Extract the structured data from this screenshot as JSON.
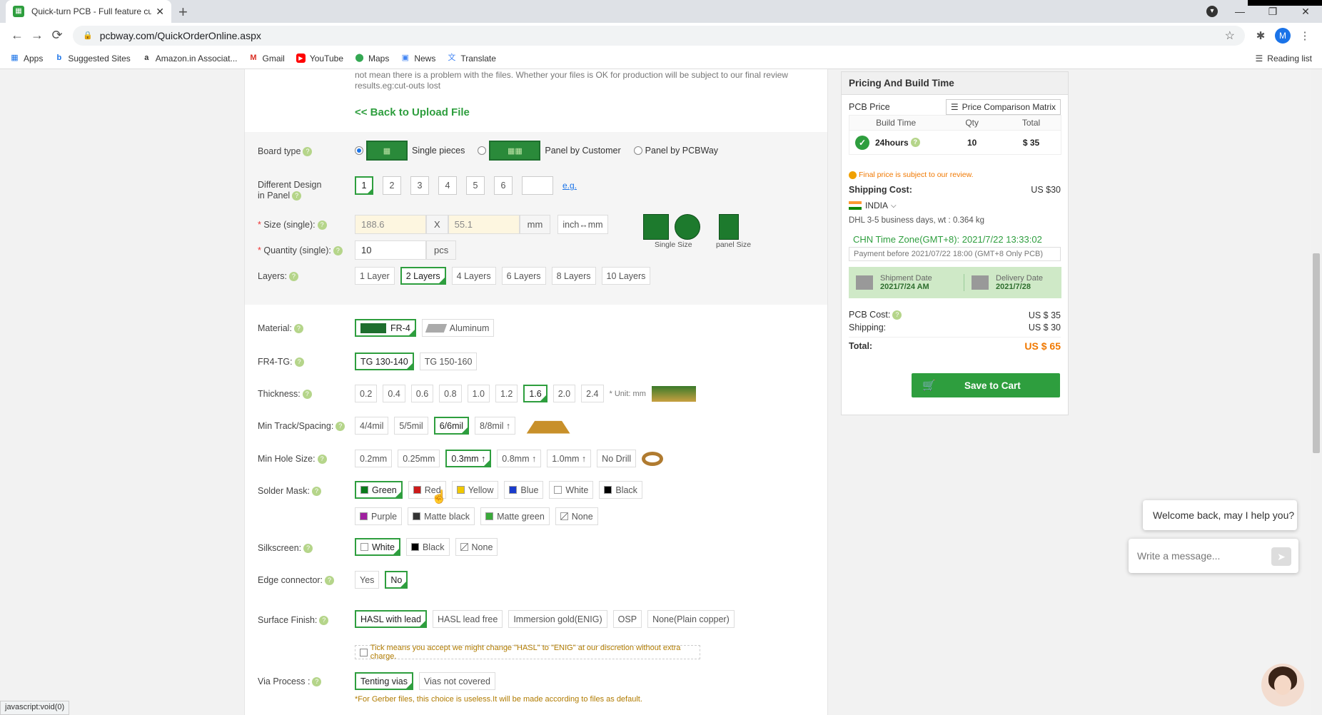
{
  "browser": {
    "tab_title": "Quick-turn PCB - Full feature cus",
    "url": "pcbway.com/QuickOrderOnline.aspx",
    "avatar_letter": "M",
    "bookmarks": [
      {
        "label": "Apps",
        "icon": "apps-grid-icon"
      },
      {
        "label": "Suggested Sites",
        "icon": "bing-icon"
      },
      {
        "label": "Amazon.in Associat...",
        "icon": "amazon-icon"
      },
      {
        "label": "Gmail",
        "icon": "gmail-icon"
      },
      {
        "label": "YouTube",
        "icon": "youtube-icon"
      },
      {
        "label": "Maps",
        "icon": "maps-icon"
      },
      {
        "label": "News",
        "icon": "news-icon"
      },
      {
        "label": "Translate",
        "icon": "translate-icon"
      }
    ],
    "reading_list": "Reading list",
    "status_text": "javascript:void(0)"
  },
  "form": {
    "notice": "Because of the imperfect algorithm of our Gerber to image tool, it may cause inaccurate display of PCB images, which does not mean there is a problem with the files. Whether your files is OK for production will be subject to our final review results.eg:cut-outs lost",
    "back_link": "<< Back to Upload File",
    "board_type": {
      "label": "Board type",
      "options": [
        "Single pieces",
        "Panel by Customer",
        "Panel by PCBWay"
      ],
      "selected": "Single pieces"
    },
    "different_design": {
      "label_line1": "Different Design",
      "label_line2": "in Panel",
      "options": [
        "1",
        "2",
        "3",
        "4",
        "5",
        "6"
      ],
      "selected": "1",
      "eg_link": "e.g."
    },
    "size": {
      "label": "Size (single):",
      "width": "188.6",
      "x": "X",
      "height": "55.1",
      "unit": "mm",
      "convert": "inch↔mm",
      "single_size_caption": "Single Size",
      "panel_size_caption": "panel Size"
    },
    "quantity": {
      "label": "Quantity (single):",
      "value": "10",
      "unit": "pcs"
    },
    "layers": {
      "label": "Layers:",
      "options": [
        "1 Layer",
        "2 Layers",
        "4 Layers",
        "6 Layers",
        "8 Layers",
        "10 Layers"
      ],
      "selected": "2 Layers"
    },
    "material": {
      "label": "Material:",
      "options": [
        "FR-4",
        "Aluminum"
      ],
      "selected": "FR-4"
    },
    "fr4_tg": {
      "label": "FR4-TG:",
      "options": [
        "TG 130-140",
        "TG 150-160"
      ],
      "selected": "TG 130-140"
    },
    "thickness": {
      "label": "Thickness:",
      "options": [
        "0.2",
        "0.4",
        "0.6",
        "0.8",
        "1.0",
        "1.2",
        "1.6",
        "2.0",
        "2.4"
      ],
      "selected": "1.6",
      "unit_note": "* Unit: mm"
    },
    "track": {
      "label": "Min Track/Spacing:",
      "options": [
        "4/4mil",
        "5/5mil",
        "6/6mil",
        "8/8mil ↑"
      ],
      "selected": "6/6mil"
    },
    "hole": {
      "label": "Min Hole Size:",
      "options": [
        "0.2mm",
        "0.25mm",
        "0.3mm ↑",
        "0.8mm ↑",
        "1.0mm ↑",
        "No Drill"
      ],
      "selected": "0.3mm ↑"
    },
    "solder_mask": {
      "label": "Solder Mask:",
      "options": [
        {
          "label": "Green",
          "color": "#0a7a1a"
        },
        {
          "label": "Red",
          "color": "#cc1a1a"
        },
        {
          "label": "Yellow",
          "color": "#f0c800"
        },
        {
          "label": "Blue",
          "color": "#1a3ccc"
        },
        {
          "label": "White",
          "color": "#ffffff"
        },
        {
          "label": "Black",
          "color": "#000000"
        },
        {
          "label": "Purple",
          "color": "#a020a0"
        },
        {
          "label": "Matte black",
          "color": "#333333"
        },
        {
          "label": "Matte green",
          "color": "#3aaa3a"
        },
        {
          "label": "None",
          "color": "none"
        }
      ],
      "selected": "Green"
    },
    "silkscreen": {
      "label": "Silkscreen:",
      "options": [
        "White",
        "Black",
        "None"
      ],
      "selected": "White"
    },
    "edge": {
      "label": "Edge connector:",
      "options": [
        "Yes",
        "No"
      ],
      "selected": "No"
    },
    "surface": {
      "label": "Surface Finish:",
      "options": [
        "HASL with lead",
        "HASL lead free",
        "Immersion gold(ENIG)",
        "OSP",
        "None(Plain copper)"
      ],
      "selected": "HASL with lead",
      "tick_note": "Tick means you accept we might change \"HASL\" to \"ENIG\" at our discretion without extra charge."
    },
    "via": {
      "label": "Via Process :",
      "options": [
        "Tenting vias",
        "Vias not covered"
      ],
      "selected": "Tenting vias",
      "note": "*For Gerber files, this choice is useless.It will be made according to files as default."
    }
  },
  "pricing": {
    "title": "Pricing And Build Time",
    "pcb_price": "PCB Price",
    "matrix_btn": "Price Comparison Matrix",
    "cols": [
      "Build Time",
      "Qty",
      "Total"
    ],
    "row": {
      "build": "24hours",
      "qty": "10",
      "total": "$ 35"
    },
    "final_note": "Final price is subject to our review.",
    "shipping_cost_label": "Shipping Cost:",
    "shipping_cost_value": "US $30",
    "country": "INDIA",
    "carrier": "DHL  3-5 business days,   wt : 0.364 kg",
    "timezone": "CHN Time Zone(GMT+8): 2021/7/22 13:33:02",
    "payment_before": "Payment before 2021/07/22 18:00 (GMT+8 Only PCB)",
    "shipment_label": "Shipment Date",
    "shipment_date": "2021/7/24 AM",
    "delivery_label": "Delivery Date",
    "delivery_date": "2021/7/28",
    "pcb_cost_label": "PCB Cost:",
    "pcb_cost": "US $ 35",
    "shipping_label": "Shipping:",
    "shipping": "US $ 30",
    "total_label": "Total:",
    "total": "US $ 65",
    "cart_btn": "Save to Cart",
    "accent": "#2e9e3e",
    "total_color": "#f07800"
  },
  "chat": {
    "welcome": "Welcome back, may I help you?",
    "placeholder": "Write a message..."
  }
}
